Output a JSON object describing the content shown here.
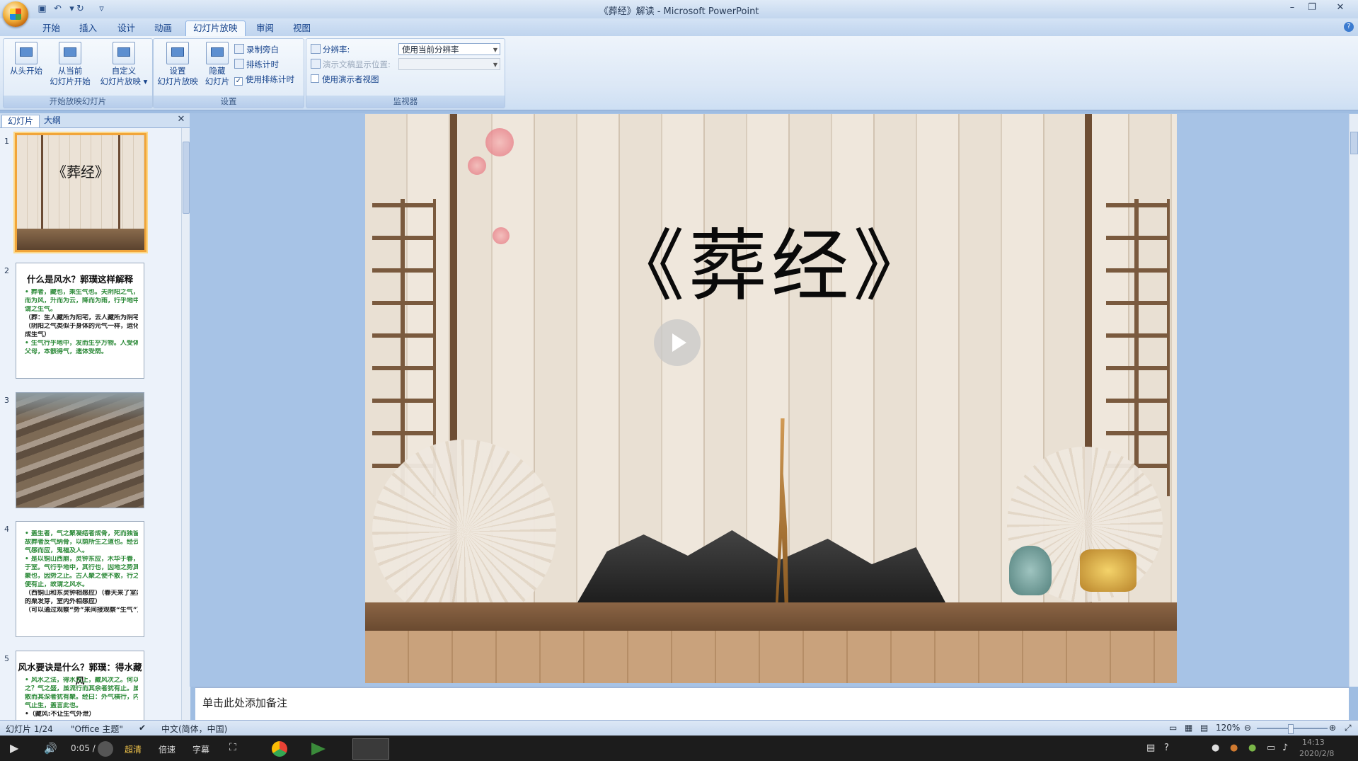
{
  "window": {
    "title": "《葬经》解读 - Microsoft PowerPoint"
  },
  "tabs": [
    "开始",
    "插入",
    "设计",
    "动画",
    "幻灯片放映",
    "审阅",
    "视图"
  ],
  "ribbon": {
    "groups": {
      "start": {
        "label": "开始放映幻灯片",
        "from_start": "从头开始",
        "from_current_l1": "从当前",
        "from_current_l2": "幻灯片开始",
        "custom_l1": "自定义",
        "custom_l2": "幻灯片放映"
      },
      "setup": {
        "label": "设置",
        "setup_l1": "设置",
        "setup_l2": "幻灯片放映",
        "hide_l1": "隐藏",
        "hide_l2": "幻灯片",
        "record": "录制旁白",
        "rehearse": "排练计时",
        "use_timings": "使用排练计时"
      },
      "monitors": {
        "label": "监视器",
        "resolution_label": "分辨率:",
        "resolution_value": "使用当前分辨率",
        "show_on_label": "演示文稿显示位置:",
        "presenter_view": "使用演示者视图"
      }
    }
  },
  "pane": {
    "tab_slides": "幻灯片",
    "tab_outline": "大纲",
    "thumbs": [
      {
        "num": "1",
        "title": "《葬经》"
      },
      {
        "num": "2",
        "title": "什么是风水？郭璞这样解释",
        "lines": [
          "• 葬者，藏也，乘生气也。夫阴阳之气，噫",
          "  而为风，升而为云，降而为雨，行乎地中，",
          "  谓之生气。",
          "（葬：生人藏所为阳宅，去人藏所为阴宅）",
          "（阴阳之气类似于身体的元气一样，运化",
          "  成生气）",
          "• 生气行乎地中，发而生乎万物。人受体于",
          "  父母，本骸得气，遗体受荫。"
        ]
      },
      {
        "num": "3"
      },
      {
        "num": "4",
        "lines": [
          "• 盖生者，气之聚凝结者成骨，死而独留。",
          "  故葬者反气纳骨，以荫所生之道也。经云：",
          "  气感而应，鬼福及人。",
          "• 是以铜山西崩，灵钟东应，木华于春，栗芽",
          "  于室。气行乎地中，其行也，因地之势其",
          "  聚也，因势之止。古人聚之使不散，行之",
          "  使有止，故谓之风水。",
          "（西铜山和东灵钟相感应）（春天来了室内",
          "  的栗发芽，室内外相感应）",
          "（可以通过观察“势”来间接观察“生气”）"
        ]
      },
      {
        "num": "5",
        "title": "风水要诀是什么？郭璞：得水藏风",
        "lines": [
          "• 风水之法，得水为上，藏风次之。何以言",
          "  之？气之盛，虽流行而其余者犹有止。虽零",
          "  散而其深者犹有聚。经曰：外气横行，内",
          "  气止生，盖言此也。",
          "•（藏风:不让生气外泄）"
        ]
      }
    ]
  },
  "slide": {
    "title": "《葬经》"
  },
  "notes": {
    "placeholder": "单击此处添加备注"
  },
  "status": {
    "slide_pos": "幻灯片 1/24",
    "theme": "\"Office 主题\"",
    "language": "中文(简体，中国)",
    "zoom": "120%"
  },
  "player": {
    "time": "0:05 /",
    "hd": "超清",
    "speed": "倍速",
    "subtitle": "字幕",
    "clock_time": "14:13",
    "clock_date": "2020/2/8"
  },
  "colors": {
    "accent": "#f1a53a",
    "ribbon": "#dbe7f6",
    "title_text": "#15428b"
  }
}
